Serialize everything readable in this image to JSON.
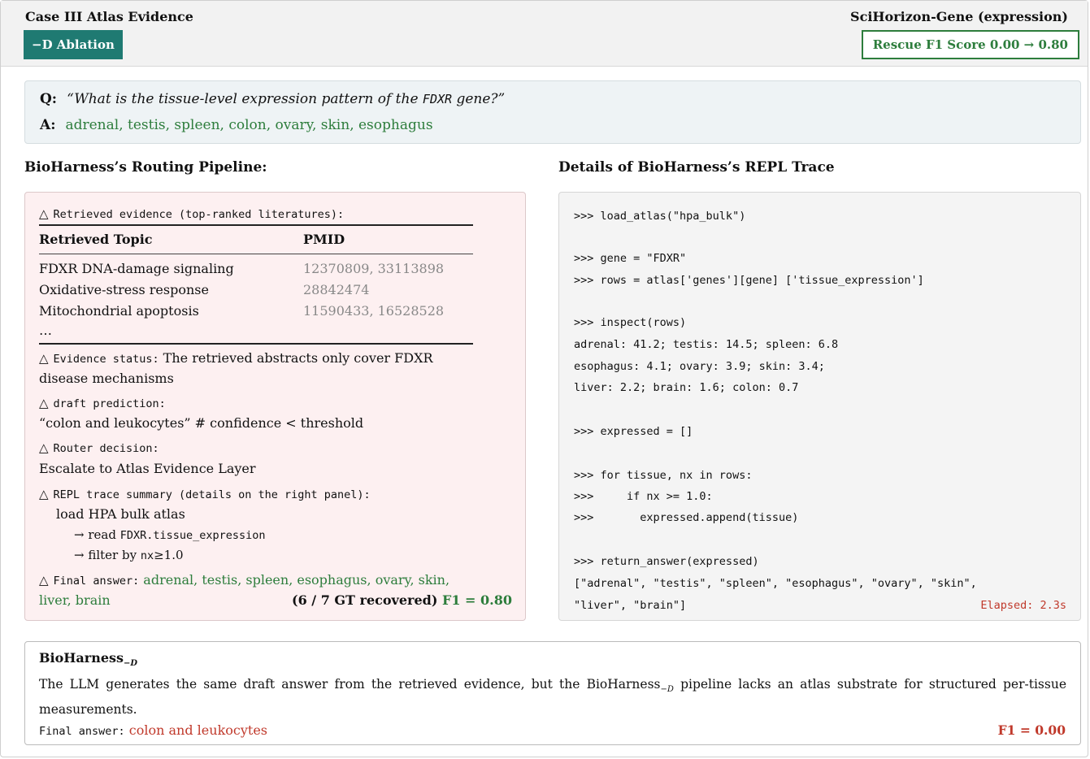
{
  "header": {
    "case_title": "Case III Atlas Evidence",
    "ablation_tag": "−D Ablation",
    "dataset_title": "SciHorizon-Gene (expression)",
    "rescue_badge": "Rescue F1 Score 0.00 → 0.80"
  },
  "qa": {
    "q_label": "Q:",
    "question_pre": "“What is the tissue-level expression pattern of the ",
    "question_gene": "FDXR",
    "question_post": " gene?”",
    "a_label": "A:",
    "answer": "adrenal, testis, spleen, colon, ovary, skin, esophagus"
  },
  "left_panel": {
    "title": "BioHarness’s Routing Pipeline:",
    "retrieved_header": "Retrieved evidence (top-ranked literatures):",
    "table": {
      "headers": [
        "Retrieved Topic",
        "PMID"
      ],
      "rows": [
        {
          "topic": "FDXR DNA-damage signaling",
          "pmid": "12370809, 33113898"
        },
        {
          "topic": "Oxidative-stress response",
          "pmid": "28842474"
        },
        {
          "topic": "Mitochondrial apoptosis",
          "pmid": "11590433, 16528528"
        }
      ],
      "ellipsis": "…"
    },
    "evidence_status_label": "Evidence status:",
    "evidence_status_text_1": " The retrieved abstracts only cover FDXR",
    "evidence_status_text_2": "disease mechanisms",
    "draft_label": "draft prediction:",
    "draft_text": "“colon and leukocytes” # confidence < threshold",
    "router_label": "Router decision:",
    "router_text": "Escalate to Atlas Evidence Layer",
    "repl_label": "REPL trace summary (details on the right panel):",
    "repl_step_1": "load HPA bulk atlas",
    "repl_step_2_arrow": "→ read ",
    "repl_step_2_code": "FDXR.tissue_expression",
    "repl_step_3_arrow": "→ filter by ",
    "repl_step_3_code": "nx",
    "repl_step_3_rest": "≥1.0",
    "final_label": "Final answer:",
    "final_text_1": " adrenal, testis, spleen, esophagus, ovary, skin,",
    "final_text_2": "liver, brain",
    "recovered": "(6 / 7 GT recovered)",
    "f1": "F1 = 0.80"
  },
  "right_panel": {
    "title": "Details of BioHarness’s REPL Trace",
    "lines": [
      ">>> load_atlas(\"hpa_bulk\")",
      ">>> gene = \"FDXR\"",
      ">>> rows = atlas['genes'][gene] ['tissue_expression']",
      ">>> inspect(rows)",
      "adrenal: 41.2; testis: 14.5; spleen: 6.8",
      "esophagus: 4.1; ovary: 3.9; skin: 3.4;",
      "liver: 2.2; brain: 1.6; colon: 0.7",
      ">>> expressed = []",
      ">>> for tissue, nx in rows:",
      ">>>     if nx >= 1.0:",
      ">>>       expressed.append(tissue)",
      ">>> return_answer(expressed)",
      "[\"adrenal\", \"testis\", \"spleen\", \"esophagus\", \"ovary\", \"skin\",",
      "\"liver\", \"brain\"]"
    ],
    "elapsed": "Elapsed: 2.3s"
  },
  "bottom": {
    "title": "BioHarness",
    "title_sub": "−D",
    "desc_1": "The LLM generates the same draft answer from the retrieved evidence, but the BioHarness",
    "desc_sub": "−D",
    "desc_2": " pipeline lacks an atlas substrate for structured per-tissue measurements.",
    "final_label": "Final answer:",
    "final_text": "colon and leukocytes",
    "f1": "F1 = 0.00"
  },
  "colors": {
    "teal_tag": "#1f7a72",
    "green": "#2d7d3c",
    "red": "#c0392b",
    "pink_panel": "#fdf0f1",
    "grey_panel": "#f4f4f4"
  },
  "icons": [
    "triangle-icon"
  ]
}
